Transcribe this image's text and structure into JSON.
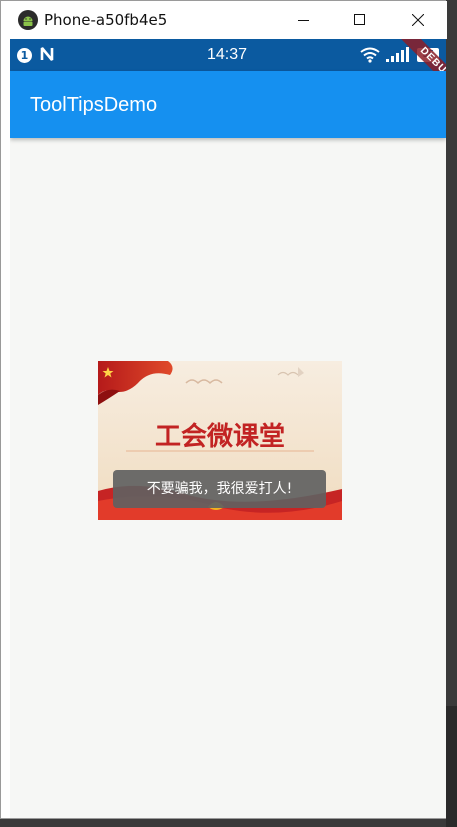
{
  "window": {
    "title": "Phone-a50fb4e5",
    "icon": "android-icon"
  },
  "status_bar": {
    "notification_count": "1",
    "notification_icon": "nfc-n-icon",
    "time": "14:37",
    "wifi_icon": "wifi-icon",
    "signal_icon": "signal-icon",
    "battery": "95"
  },
  "debug_banner": "DEBUG",
  "app_bar": {
    "title": "ToolTipsDemo",
    "color": "#1590f0"
  },
  "image": {
    "caption_text": "工会微课堂"
  },
  "tooltip": {
    "message": "不要骗我，我很爱打人!"
  }
}
